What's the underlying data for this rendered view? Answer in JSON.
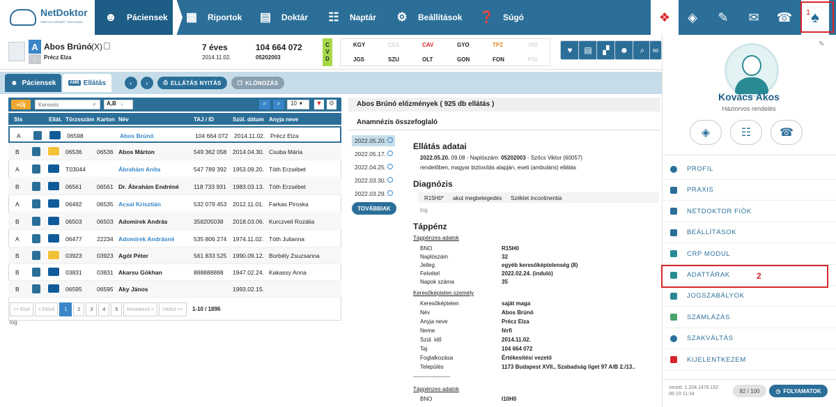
{
  "logo": {
    "name": "NetDoktor",
    "tagline": "TARTSA SZEMÉT PRAXISÁN"
  },
  "nav": [
    {
      "label": "Páciensek",
      "icon": "patients-icon"
    },
    {
      "label": "Riportok",
      "icon": "report-icon"
    },
    {
      "label": "Doktár",
      "icon": "books-icon"
    },
    {
      "label": "Naptár",
      "icon": "calendar-icon"
    },
    {
      "label": "Beállítások",
      "icon": "gear-icon"
    },
    {
      "label": "Súgó",
      "icon": "help-chat-icon"
    }
  ],
  "patient": {
    "letter": "A",
    "name": "Abos Brúnó",
    "mark": "(X)",
    "mother": "Précz Elza",
    "age": "7 éves",
    "birth": "2014.11.02.",
    "taj": "104 664 072",
    "code": "05202003",
    "cvd": [
      "C",
      "V",
      "D"
    ]
  },
  "flags": {
    "row1": [
      "KGY",
      "CES",
      "CAV",
      "GYO",
      "TPZ",
      "VIG"
    ],
    "row2": [
      "JGS",
      "SZU",
      "OLT",
      "GON",
      "FON",
      "PSI"
    ]
  },
  "tabs": {
    "patients": "Páciensek",
    "care": "Ellátás",
    "amb": "AMB",
    "open": "ELLÁTÁS NYITÁS",
    "clone": "KLÓNOZÁS"
  },
  "list": {
    "add": "+Új",
    "search_placeholder": "Keresés",
    "sort": "A,B",
    "page_size": "10",
    "columns": [
      "Sts",
      "Ellát.",
      "Törzsszám",
      "Karton",
      "Név",
      "TAJ / ID",
      "Szül. dátum",
      "Anyja neve"
    ],
    "rows": [
      {
        "sts": "A",
        "torzs": "06598",
        "karton": "",
        "nev": "Abos Brúnó",
        "taj": "104 664 072",
        "szul": "2014.11.02.",
        "anya": "Précz Elza"
      },
      {
        "sts": "B",
        "torzs": "06536",
        "karton": "06536",
        "nev": "Abos Márton",
        "taj": "549 362 058",
        "szul": "2014.04.30.",
        "anya": "Csuba Mária"
      },
      {
        "sts": "A",
        "torzs": "T03044",
        "karton": "",
        "nev": "Ábrahám Anita",
        "taj": "547 789 392",
        "szul": "1953.09.20.",
        "anya": "Tóth Erzsébet"
      },
      {
        "sts": "B",
        "torzs": "06561",
        "karton": "06561",
        "nev": "Dr. Ábrahám Endréné",
        "taj": "118 733 931",
        "szul": "1983.03.13.",
        "anya": "Tóth Erzsébet"
      },
      {
        "sts": "A",
        "torzs": "06492",
        "karton": "06535",
        "nev": "Acsai Krisztián",
        "taj": "532 079 453",
        "szul": "2012.11.01.",
        "anya": "Farkas Piroska"
      },
      {
        "sts": "B",
        "torzs": "06503",
        "karton": "06503",
        "nev": "Adomirek András",
        "taj": "358205038",
        "szul": "2018.03.06.",
        "anya": "Kurczveil Rozália"
      },
      {
        "sts": "A",
        "torzs": "06477",
        "karton": "22234",
        "nev": "Adomirek Andrásné",
        "taj": "535 806 274",
        "szul": "1974.11.02.",
        "anya": "Tóth Julianna"
      },
      {
        "sts": "B",
        "torzs": "03923",
        "karton": "03923",
        "nev": "Agót Péter",
        "taj": "561 833 525",
        "szul": "1990.09.12.",
        "anya": "Borbély Zsuzsanna"
      },
      {
        "sts": "B",
        "torzs": "03831",
        "karton": "03831",
        "nev": "Akarsu Gökhan",
        "taj": "888888888",
        "szul": "1947.02.24.",
        "anya": "Kakassy Anna"
      },
      {
        "sts": "B",
        "torzs": "06595",
        "karton": "06595",
        "nev": "Aky János",
        "taj": "",
        "szul": "1993.02.15.",
        "anya": ""
      }
    ],
    "pager": [
      "<< Első",
      "< Előző",
      "1",
      "2",
      "3",
      "4",
      "5",
      "Következő >",
      "Utolsó >>"
    ],
    "range": "1-10 / 1896",
    "log": "log"
  },
  "history": {
    "title": "Abos Brúnó előzmények ( 925 db ellátás )",
    "anamnesis": "Anamnézis összefoglaló",
    "dates": [
      "2022.05.20.",
      "2022.05.17.",
      "2022.04.25.",
      "2022.03.30.",
      "2022.03.29."
    ],
    "more": "TOVÁBBIAK",
    "care_title": "Ellátás adatai",
    "care_date": "2022.05.20.",
    "care_rest": "09.08 - Naplószám:",
    "care_num": "05202003",
    "care_doc": "- Szőcs Viktor (60057)",
    "care_line2": "rendelőben, magyar biztosítás alapján, eseti (ambuláns) ellátás",
    "diag_title": "Diagnózis",
    "diag_code": "R15H0*",
    "diag_type": "akut megbetegedés",
    "diag_text": "Széklet incontinentia",
    "diag_log": "log",
    "sick_title": "Táppénz",
    "sick_sub": "Táppénzes adatok",
    "sick_rows": [
      {
        "l": "BNO",
        "v": "R15H0"
      },
      {
        "l": "Naplószám",
        "v": "32"
      },
      {
        "l": "Jelleg",
        "v": "egyéb keresőképtelenség (8)"
      },
      {
        "l": "Felvétel",
        "v": "2022.02.24. (induló)"
      },
      {
        "l": "Napok száma",
        "v": "35"
      }
    ],
    "person_sub": "Keresőképtelen személy",
    "person_rows": [
      {
        "l": "Keresőképtelen",
        "v": "saját maga"
      },
      {
        "l": "Név",
        "v": "Abos Brúnó"
      },
      {
        "l": "Anyja neve",
        "v": "Précz Elza"
      },
      {
        "l": "Neme",
        "v": "férfi"
      },
      {
        "l": "Szül. idő",
        "v": "2014.11.02."
      },
      {
        "l": "Taj",
        "v": "104 664 072"
      },
      {
        "l": "Foglalkozása",
        "v": "Értékesítési vezető"
      },
      {
        "l": "Település",
        "v": "1173 Budapest XVII., Szabadság liget 97 A/B 2./13.."
      }
    ],
    "dashes": "--------------------",
    "sick_sub2": "Táppénzes adatok",
    "bno2": "BNO",
    "bno2_val": "I10H0"
  },
  "user": {
    "name": "Kovács Ákos",
    "role": "Háziorvos rendelés",
    "menu": [
      {
        "label": "PROFIL",
        "icon": "person-icon"
      },
      {
        "label": "PRAXIS",
        "icon": "gears-icon"
      },
      {
        "label": "NETDOKTOR FIÓK",
        "icon": "gears-icon"
      },
      {
        "label": "BEÁLLÍTÁSOK",
        "icon": "gears-icon"
      },
      {
        "label": "CRP MODUL",
        "icon": "grid-icon"
      },
      {
        "label": "ADATTÁRAK",
        "icon": "grid-icon"
      },
      {
        "label": "JOGSZABÁLYOK",
        "icon": "grid-icon"
      },
      {
        "label": "SZÁMLÁZÁS",
        "icon": "invoice-icon"
      },
      {
        "label": "SZAKVÁLTÁS",
        "icon": "location-icon"
      },
      {
        "label": "KIJELENTKEZEM",
        "icon": "logout-icon"
      }
    ],
    "version": "verzió: 1.204.1478.152",
    "version_date": "05-19 11:34",
    "counter": "82 / 100",
    "process": "FOLYAMATOK"
  },
  "annotations": {
    "one": "1",
    "two": "2"
  },
  "colors": {
    "primary": "#2b6f99",
    "dark": "#1d5d86",
    "accent": "#3a86c8",
    "highlight": "#d6252b"
  }
}
